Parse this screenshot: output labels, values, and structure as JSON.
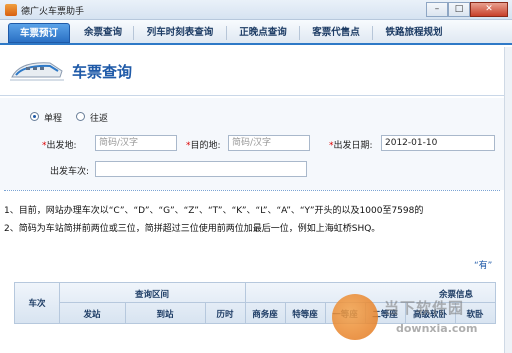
{
  "window": {
    "title": "德广火车票助手",
    "min": "–",
    "max": "□",
    "close": "✕"
  },
  "tabs": [
    "车票预订",
    "余票查询",
    "列车时刻表查询",
    "正晚点查询",
    "客票代售点",
    "铁路旅程规划"
  ],
  "header": {
    "title": "车票查询"
  },
  "form": {
    "trip_one_way": "单程",
    "trip_round": "往返",
    "from_label": "出发地:",
    "from_placeholder": "简码/汉字",
    "to_label": "目的地:",
    "to_placeholder": "简码/汉字",
    "date_label": "出发日期:",
    "date_value": "2012-01-10",
    "train_label": "出发车次:",
    "required_mark": "*"
  },
  "notes": [
    "1、目前，网站办理车次以“C”、“D”、“G”、“Z”、“T”、“K”、“L”、“A”、“Y”开头的以及1000至7598的",
    "2、简码为车站简拼前两位或三位，简拼超过三位使用前两位加最后一位，例如上海虹桥SHQ。"
  ],
  "link_has": "“有”",
  "table": {
    "col_train": "车次",
    "group_interval": "查询区间",
    "group_seats": "余票信息",
    "col_from": "发站",
    "col_to": "到站",
    "col_duration": "历时",
    "col_business": "商务座",
    "col_special": "特等座",
    "col_first": "一等座",
    "col_second": "二等座",
    "col_soft_sleeper": "高级软卧",
    "col_soft": "软卧"
  },
  "watermark": {
    "text": "当下软件园",
    "sub": "downxia.com"
  }
}
